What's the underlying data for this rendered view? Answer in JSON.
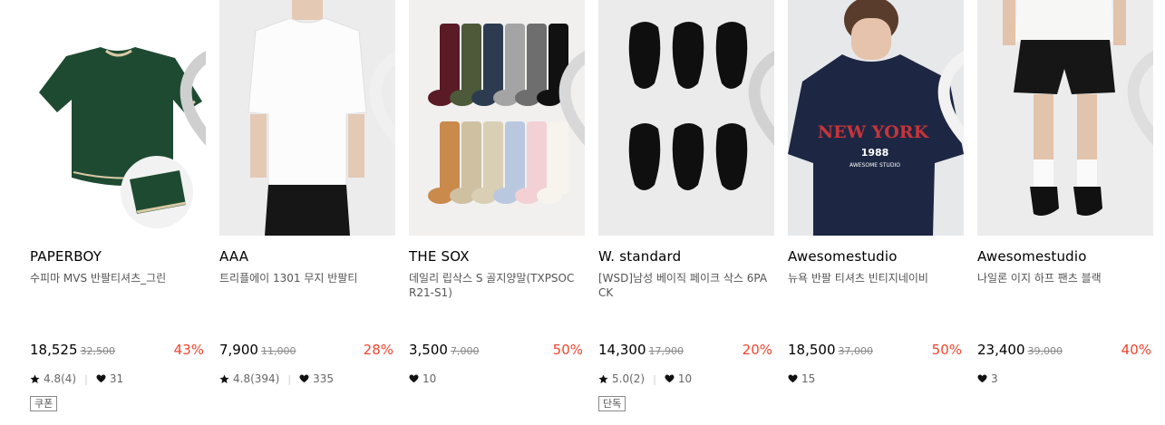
{
  "products": [
    {
      "brand": "PAPERBOY",
      "name": "수피마 MVS 반팔티셔츠_그린",
      "price": "18,525",
      "original_price": "32,500",
      "discount": "43%",
      "rating": "4.8(4)",
      "likes": "31",
      "badge": "쿠폰",
      "image": "green-tshirt"
    },
    {
      "brand": "AAA",
      "name": "트리플에이 1301 무지 반팔티",
      "price": "7,900",
      "original_price": "11,000",
      "discount": "28%",
      "rating": "4.8(394)",
      "likes": "335",
      "badge": "",
      "image": "white-tshirt-model"
    },
    {
      "brand": "THE SOX",
      "name": "데일리 립삭스 S 골지양말(TXPSOCR21-S1)",
      "price": "3,500",
      "original_price": "7,000",
      "discount": "50%",
      "rating": "",
      "likes": "10",
      "badge": "",
      "image": "rib-socks"
    },
    {
      "brand": "W. standard",
      "name": "[WSD]남성 베이직 페이크 삭스 6PACK",
      "price": "14,300",
      "original_price": "17,900",
      "discount": "20%",
      "rating": "5.0(2)",
      "likes": "10",
      "badge": "단독",
      "image": "black-fake-socks"
    },
    {
      "brand": "Awesomestudio",
      "name": "뉴욕 반팔 티셔츠 빈티지네이비",
      "price": "18,500",
      "original_price": "37,000",
      "discount": "50%",
      "rating": "",
      "likes": "15",
      "badge": "",
      "image": "navy-newyork-tshirt"
    },
    {
      "brand": "Awesomestudio",
      "name": "나일론 이지 하프 팬츠 블랙",
      "price": "23,400",
      "original_price": "39,000",
      "discount": "40%",
      "rating": "",
      "likes": "3",
      "badge": "",
      "image": "black-half-pants"
    }
  ],
  "thumbnail_text": {
    "p4_line1": "NEW YORK",
    "p4_line2": "1988",
    "p4_line3": "AWESOME STUDIO"
  },
  "colors": {
    "discount": "#f2452e",
    "text": "#000000",
    "muted": "#555555"
  }
}
